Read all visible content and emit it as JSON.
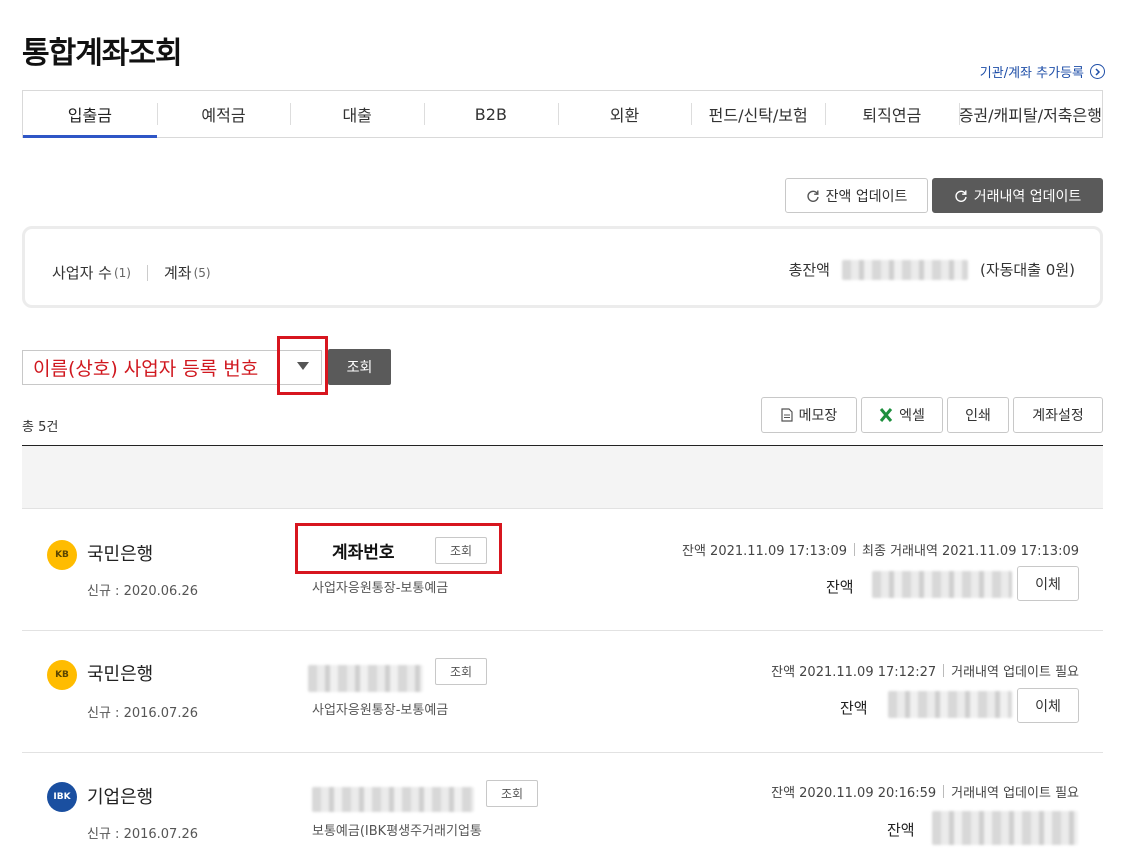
{
  "page": {
    "title": "통합계좌조회",
    "add_link": "기관/계좌 추가등록"
  },
  "tabs": [
    {
      "label": "입출금"
    },
    {
      "label": "예적금"
    },
    {
      "label": "대출"
    },
    {
      "label": "B2B"
    },
    {
      "label": "외환"
    },
    {
      "label": "펀드/신탁/보험"
    },
    {
      "label": "퇴직연금"
    },
    {
      "label": "증권/캐피탈/저축은행"
    }
  ],
  "actions": {
    "balance_update": "잔액 업데이트",
    "history_update": "거래내역 업데이트"
  },
  "summary": {
    "business_label": "사업자 수",
    "business_count": "(1)",
    "account_label": "계좌",
    "account_count": "(5)",
    "total_label": "총잔액",
    "auto_loan": "(자동대출 0원)"
  },
  "search": {
    "field_text": "이름(상호) 사업자 등록 번호",
    "button": "조회"
  },
  "list": {
    "count": "총 5건",
    "memo": "메모장",
    "excel": "엑셀",
    "print": "인쇄",
    "settings": "계좌설정"
  },
  "accounts": [
    {
      "bank": "국민은행",
      "logo": "KB",
      "opened": "신규 : 2020.06.26",
      "acct_label": "계좌번호",
      "query": "조회",
      "type": "사업자응원통장-보통예금",
      "meta_balance": "잔액 2021.11.09 17:13:09",
      "meta_history": "최종 거래내역 2021.11.09 17:13:09",
      "bal_label": "잔액",
      "transfer": "이체"
    },
    {
      "bank": "국민은행",
      "logo": "KB",
      "opened": "신규 : 2016.07.26",
      "query": "조회",
      "type": "사업자응원통장-보통예금",
      "meta_balance": "잔액 2021.11.09 17:12:27",
      "meta_history": "거래내역 업데이트 필요",
      "bal_label": "잔액",
      "transfer": "이체"
    },
    {
      "bank": "기업은행",
      "logo": "IBK",
      "opened": "신규 : 2016.07.26",
      "query": "조회",
      "type": "보통예금(IBK평생주거래기업통",
      "meta_balance": "잔액 2020.11.09 20:16:59",
      "meta_history": "거래내역 업데이트 필요",
      "bal_label": "잔액"
    }
  ]
}
